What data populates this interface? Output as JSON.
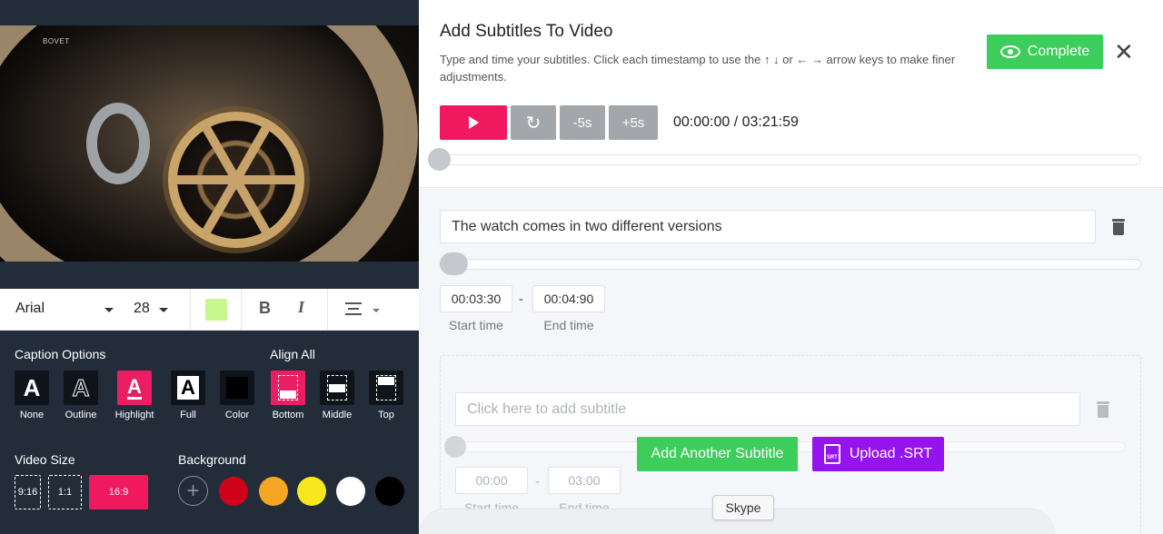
{
  "video": {
    "brand_text": "BOVET"
  },
  "toolbar": {
    "font": "Arial",
    "size": "28",
    "color": "#c6f68d"
  },
  "caption_options": {
    "label": "Caption Options",
    "items": [
      {
        "label": "None",
        "active": false
      },
      {
        "label": "Outline",
        "active": false
      },
      {
        "label": "Highlight",
        "active": true
      },
      {
        "label": "Full",
        "active": false
      },
      {
        "label": "Color",
        "active": false
      }
    ]
  },
  "align_all": {
    "label": "Align All",
    "items": [
      {
        "label": "Bottom",
        "active": true
      },
      {
        "label": "Middle",
        "active": false
      },
      {
        "label": "Top",
        "active": false
      }
    ]
  },
  "video_size": {
    "label": "Video Size",
    "items": [
      {
        "label": "9:16",
        "active": false
      },
      {
        "label": "1:1",
        "active": false
      },
      {
        "label": "16:9",
        "active": true
      }
    ]
  },
  "background": {
    "label": "Background",
    "add_icon": "plus-icon",
    "colors": [
      "#d0021b",
      "#f5a623",
      "#f8e71c",
      "#ffffff",
      "#000000"
    ]
  },
  "header": {
    "title": "Add Subtitles To Video",
    "subtitle": "Type and time your subtitles. Click each timestamp to use the ↑ ↓ or ← → arrow keys to make finer adjustments.",
    "complete_label": "Complete",
    "close_glyph": "✕"
  },
  "player": {
    "play_icon": "play-icon",
    "replay_glyph": "↻",
    "back_label": "-5s",
    "forward_label": "+5s",
    "time": "00:00:00 / 03:21:59",
    "progress": 0
  },
  "subtitles": [
    {
      "text": "The watch comes in two different versions",
      "start": "00:03:30",
      "end": "00:04:90",
      "start_label": "Start time",
      "end_label": "End time"
    }
  ],
  "new_subtitle": {
    "placeholder": "Click here to add subtitle",
    "start": "00:00",
    "end": "03:00",
    "start_label": "Start time",
    "end_label": "End time"
  },
  "actions": {
    "add_label": "Add Another Subtitle",
    "upload_label": "Upload .SRT",
    "upload_icon_text": "SRT"
  },
  "tooltip": "Skype",
  "colors": {
    "accent_pink": "#f0195f",
    "accent_green": "#3ccd5b",
    "accent_purple": "#9513ee",
    "panel_dark": "#232c39"
  }
}
